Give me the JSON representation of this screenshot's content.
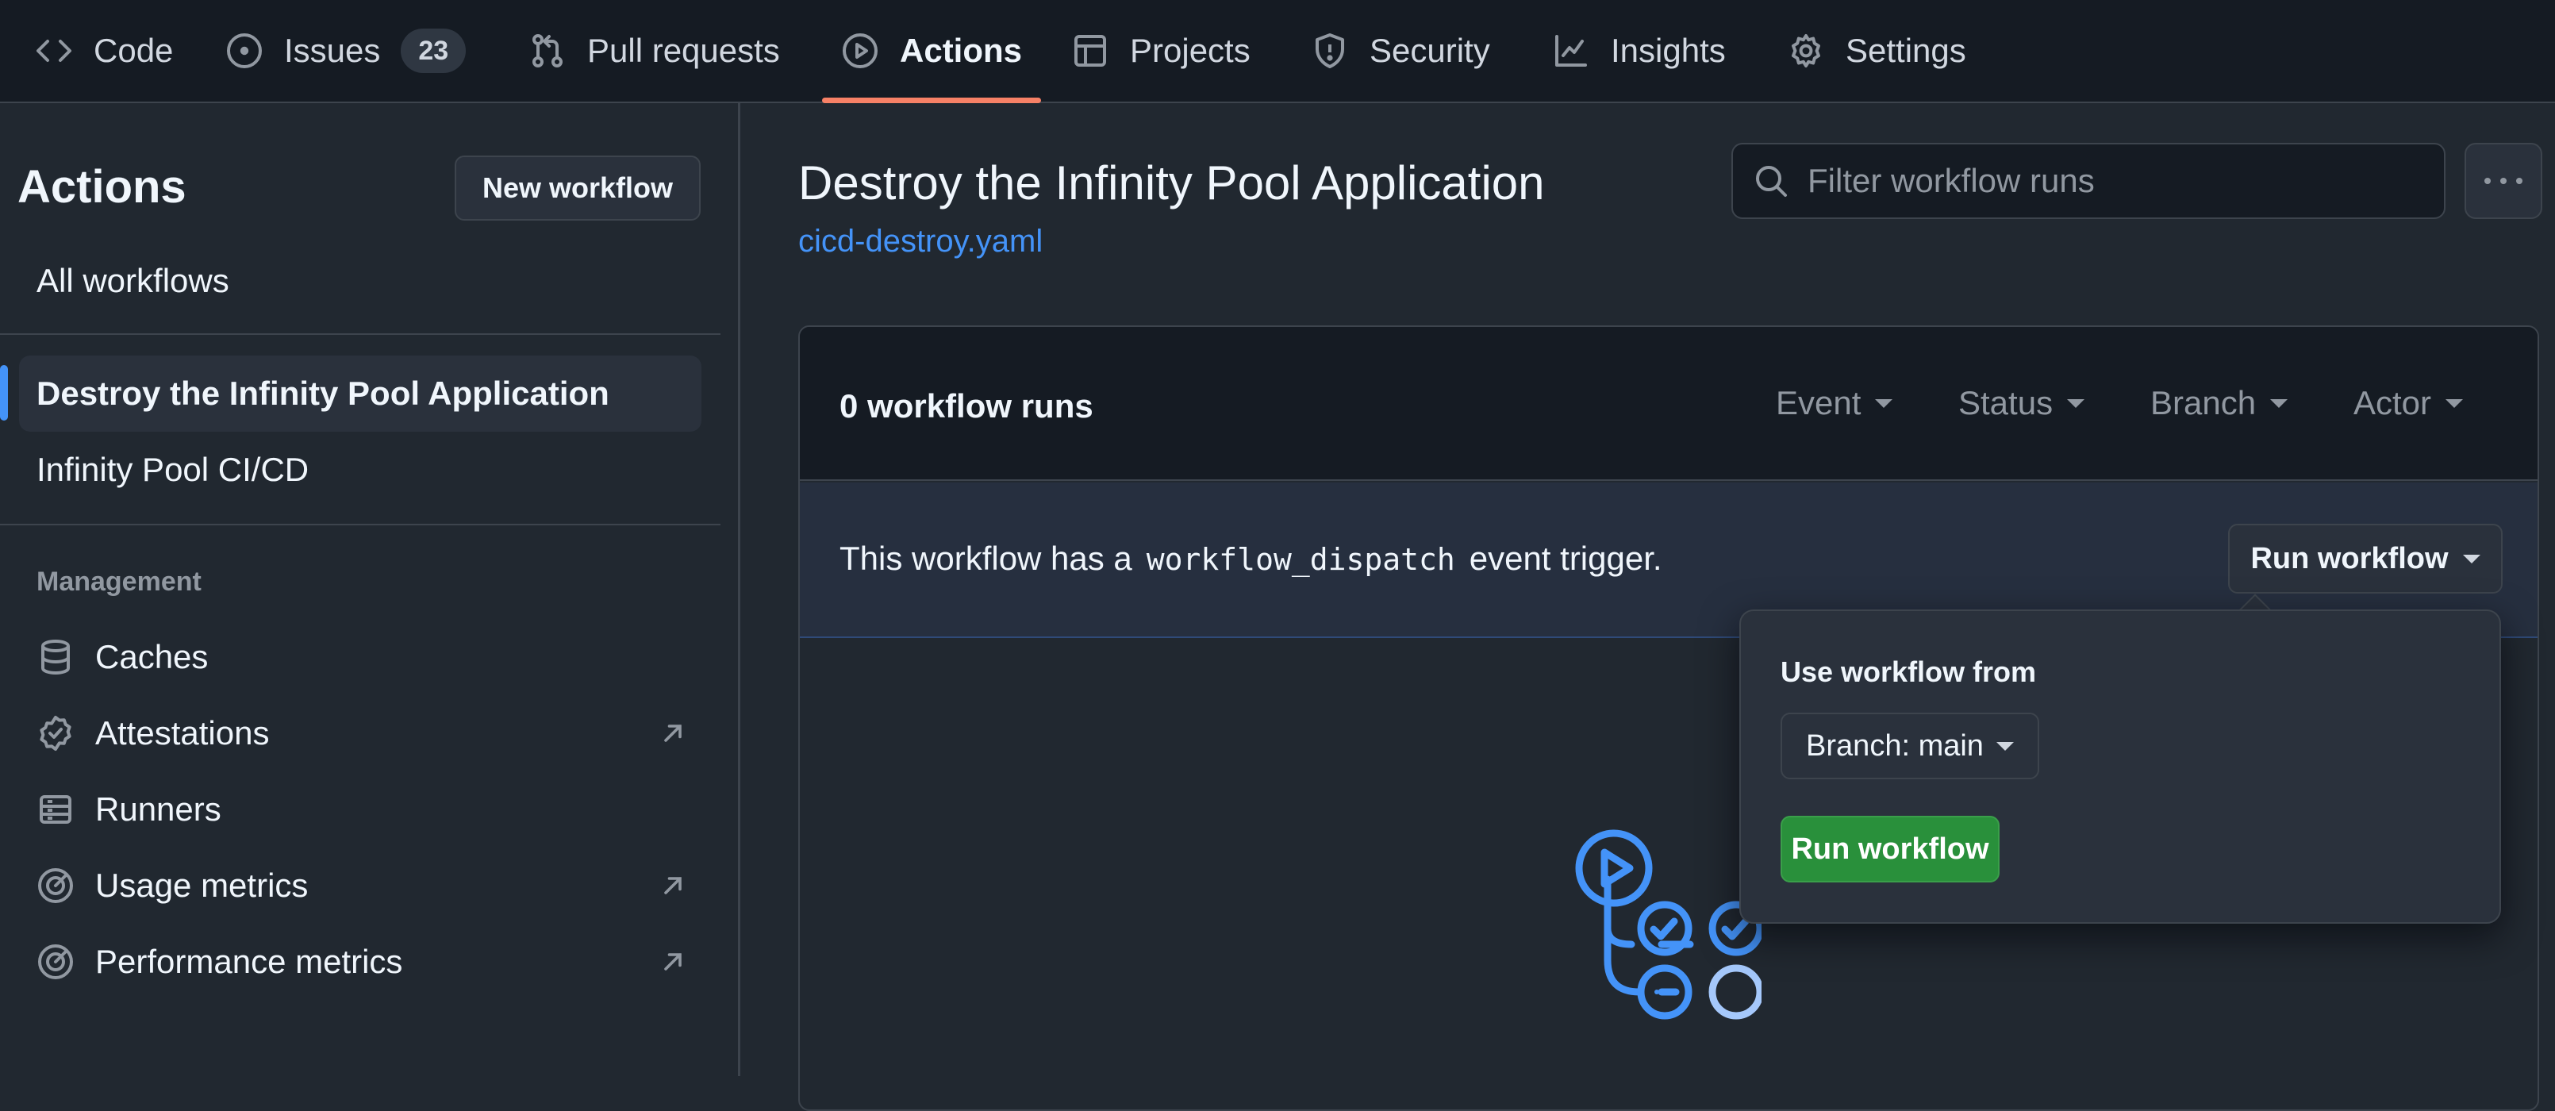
{
  "topnav": {
    "tabs": [
      {
        "label": "Code",
        "icon": "code-icon"
      },
      {
        "label": "Issues",
        "icon": "issue-opened-icon",
        "count": "23"
      },
      {
        "label": "Pull requests",
        "icon": "git-pull-request-icon"
      },
      {
        "label": "Actions",
        "icon": "play-icon",
        "selected": true
      },
      {
        "label": "Projects",
        "icon": "table-icon"
      },
      {
        "label": "Security",
        "icon": "shield-icon"
      },
      {
        "label": "Insights",
        "icon": "graph-icon"
      },
      {
        "label": "Settings",
        "icon": "gear-icon"
      }
    ],
    "selected_underline_color": "#f78166"
  },
  "sidebar": {
    "title": "Actions",
    "new_workflow_label": "New workflow",
    "all_workflows_label": "All workflows",
    "workflows": [
      {
        "label": "Destroy the Infinity Pool Application",
        "active": true
      },
      {
        "label": "Infinity Pool CI/CD",
        "active": false
      }
    ],
    "management_heading": "Management",
    "management_items": [
      {
        "label": "Caches",
        "icon": "database-icon",
        "external": false
      },
      {
        "label": "Attestations",
        "icon": "verified-icon",
        "external": true
      },
      {
        "label": "Runners",
        "icon": "server-icon",
        "external": false
      },
      {
        "label": "Usage metrics",
        "icon": "meter-icon",
        "external": true
      },
      {
        "label": "Performance metrics",
        "icon": "meter-icon",
        "external": true
      }
    ]
  },
  "main": {
    "workflow_title": "Destroy the Infinity Pool Application",
    "workflow_file": "cicd-destroy.yaml",
    "filter_placeholder": "Filter workflow runs",
    "runs_count": "0 workflow runs",
    "filters": [
      "Event",
      "Status",
      "Branch",
      "Actor"
    ],
    "dispatch": {
      "prefix": "This workflow has a",
      "code": "workflow_dispatch",
      "suffix": "event trigger.",
      "run_button_label": "Run workflow"
    }
  },
  "popover": {
    "label": "Use workflow from",
    "branch_label": "Branch: main",
    "run_label": "Run workflow",
    "run_color": "#29903b"
  },
  "colors": {
    "link": "#4493f8",
    "accent_bar": "#4493f8",
    "background": "#212830",
    "header_background": "#151b23"
  }
}
